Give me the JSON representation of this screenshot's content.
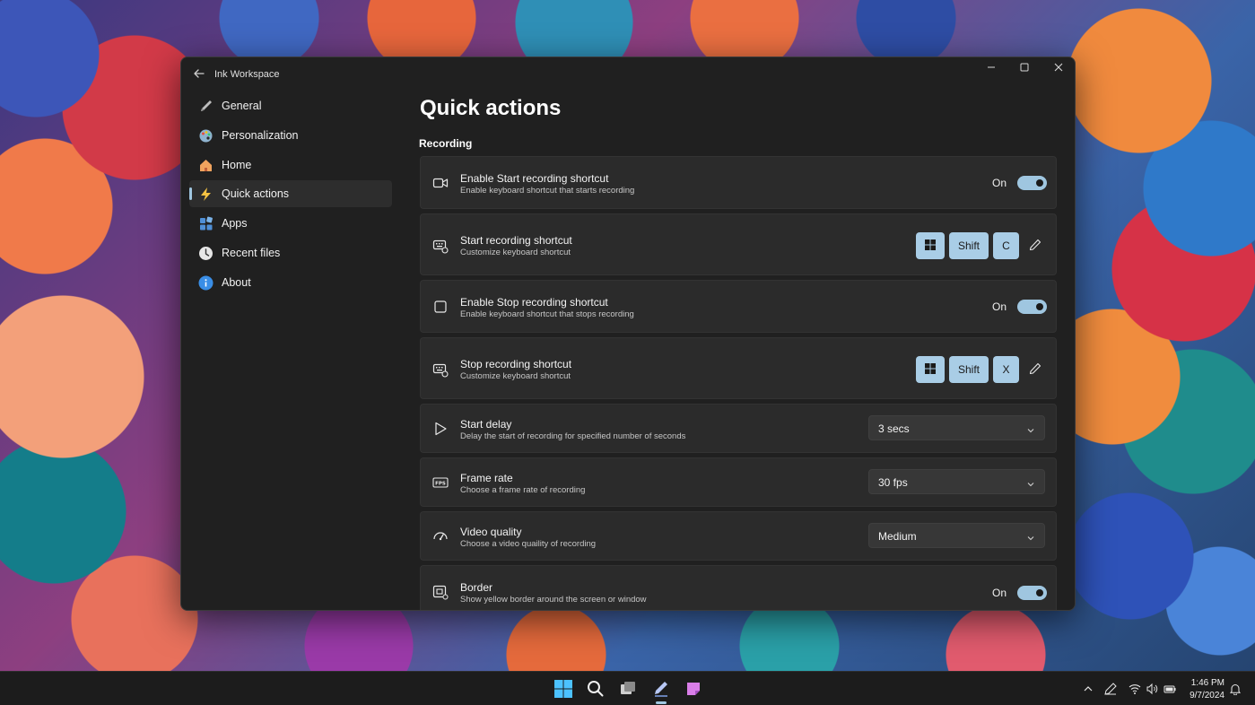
{
  "window": {
    "app_title": "Ink Workspace"
  },
  "sidebar": {
    "items": [
      {
        "label": "General",
        "icon": "pen-icon"
      },
      {
        "label": "Personalization",
        "icon": "palette-icon"
      },
      {
        "label": "Home",
        "icon": "home-icon"
      },
      {
        "label": "Quick actions",
        "icon": "lightning-icon",
        "active": true
      },
      {
        "label": "Apps",
        "icon": "apps-icon"
      },
      {
        "label": "Recent files",
        "icon": "clock-icon"
      },
      {
        "label": "About",
        "icon": "info-icon"
      }
    ]
  },
  "main": {
    "page_title": "Quick actions",
    "section_title": "Recording",
    "settings": [
      {
        "title": "Enable Start recording shortcut",
        "desc": "Enable keyboard shortcut that starts recording",
        "icon": "video-camera-icon",
        "toggle_label": "On"
      },
      {
        "title": "Start recording shortcut",
        "desc": "Customize keyboard shortcut",
        "icon": "keyboard-icon",
        "keys": [
          "Win",
          "Shift",
          "C"
        ]
      },
      {
        "title": "Enable Stop recording shortcut",
        "desc": "Enable keyboard shortcut that stops recording",
        "icon": "stop-square-icon",
        "toggle_label": "On"
      },
      {
        "title": "Stop recording shortcut",
        "desc": "Customize keyboard shortcut",
        "icon": "keyboard-icon",
        "keys": [
          "Win",
          "Shift",
          "X"
        ]
      },
      {
        "title": "Start delay",
        "desc": "Delay the start of recording for specified number of seconds",
        "icon": "play-icon",
        "dropdown": "3 secs"
      },
      {
        "title": "Frame rate",
        "desc": "Choose a frame rate of recording",
        "icon": "fps-icon",
        "dropdown": "30 fps"
      },
      {
        "title": "Video quality",
        "desc": "Choose a video quaility of recording",
        "icon": "quality-icon",
        "dropdown": "Medium"
      },
      {
        "title": "Border",
        "desc": "Show yellow border around the screen or window",
        "icon": "border-icon",
        "toggle_label": "On"
      }
    ]
  },
  "taskbar": {
    "clock_time": "1:46 PM",
    "clock_date": "9/7/2024"
  },
  "colors": {
    "accent": "#9fc6e0",
    "key_bg": "#a9cde6",
    "window_bg": "#202020",
    "card_bg": "#2b2b2b"
  }
}
